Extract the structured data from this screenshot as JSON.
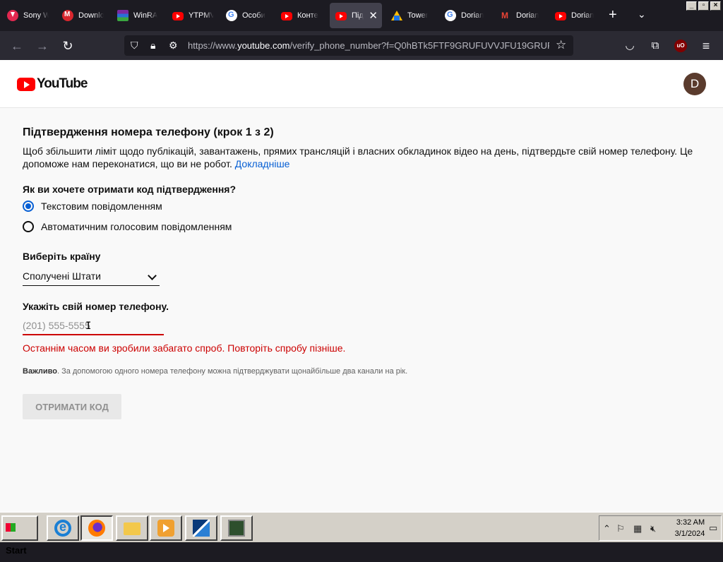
{
  "browser": {
    "tabs": [
      {
        "label": "Sony W",
        "favicon": "download-icon"
      },
      {
        "label": "Downlo",
        "favicon": "mega-icon"
      },
      {
        "label": "WinRA",
        "favicon": "winrar-icon"
      },
      {
        "label": "YTPMV",
        "favicon": "youtube-icon"
      },
      {
        "label": "Особи",
        "favicon": "google-icon"
      },
      {
        "label": "Конте",
        "favicon": "youtube-icon"
      },
      {
        "label": "Під",
        "favicon": "youtube-icon",
        "active": true
      },
      {
        "label": "Tower",
        "favicon": "google-drive-icon"
      },
      {
        "label": "Dorian",
        "favicon": "google-icon"
      },
      {
        "label": "Dorian",
        "favicon": "gmail-icon"
      },
      {
        "label": "Dorian",
        "favicon": "youtube-icon"
      }
    ],
    "url_prefix": "https://www.",
    "url_domain": "youtube.com",
    "url_rest": "/verify_phone_number?f=Q0hBTk5FTF9GRUFUVVJFU19GRUFUV"
  },
  "page": {
    "logo_text": "YouTube",
    "avatar_letter": "D",
    "title": "Підтвердження номера телефону (крок 1 з 2)",
    "description": "Щоб збільшити ліміт щодо публікацій, завантажень, прямих трансляцій і власних обкладинок відео на день, підтвердьте свій номер телефону. Це допоможе нам переконатися, що ви не робот.",
    "learn_more": "Докладніше",
    "method_question": "Як ви хочете отримати код підтвердження?",
    "method_options": [
      {
        "label": "Текстовим повідомленням",
        "selected": true
      },
      {
        "label": "Автоматичним голосовим повідомленням",
        "selected": false
      }
    ],
    "country_label": "Виберіть країну",
    "country_value": "Сполучені Штати",
    "phone_label": "Укажіть свій номер телефону.",
    "phone_value": "",
    "phone_placeholder": "(201) 555-5555",
    "error_text": "Останнім часом ви зробили забагато спроб. Повторіть спробу пізніше.",
    "note_bold": "Важливо",
    "note_text": ". За допомогою одного номера телефону можна підтверджувати щонайбільше два канали на рік.",
    "submit_label": "ОТРИМАТИ КОД"
  },
  "taskbar": {
    "start_label": "Start",
    "time": "3:32 AM",
    "date": "3/1/2024"
  },
  "colors": {
    "accent": "#065fd4",
    "error": "#cc0000",
    "youtube_red": "#ff0000"
  }
}
